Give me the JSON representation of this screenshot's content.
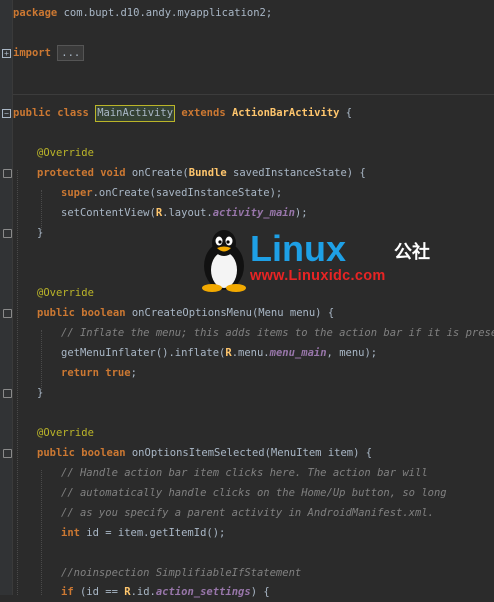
{
  "editor": {
    "theme_colors": {
      "background": "#2b2b2b",
      "keyword": "#cc7832",
      "annotation": "#bbb529",
      "comment": "#808080",
      "field": "#9876aa",
      "type": "#ffc66d"
    },
    "code": {
      "pkg_kw": "package",
      "pkg_name": " com.bupt.d10.andy.myapplication2;",
      "import_kw": "import",
      "import_folded": "...",
      "class_kw1": "public",
      "class_kw2": "class",
      "class_name": "MainActivity",
      "extends_kw": "extends",
      "super_class": "ActionBarActivity",
      "class_brace": " {",
      "ann1": "@Override",
      "m1_kw1": "protected",
      "m1_kw2": "void",
      "m1_name": " onCreate(",
      "m1_type": "Bundle",
      "m1_param": " savedInstanceState) {",
      "m1_l1_kw": "super",
      "m1_l1_rest": ".onCreate(savedInstanceState);",
      "m1_l2_a": "setContentView(",
      "m1_l2_R": "R",
      "m1_l2_b": ".layout.",
      "m1_l2_field": "activity_main",
      "m1_l2_c": ");",
      "close1": "}",
      "ann2": "@Override",
      "m2_kw1": "public",
      "m2_kw2": "boolean",
      "m2_sig": " onCreateOptionsMenu(Menu menu) {",
      "m2_comment": "// Inflate the menu; this adds items to the action bar if it is present.",
      "m2_l2_a": "getMenuInflater().inflate(",
      "m2_l2_R": "R",
      "m2_l2_b": ".menu.",
      "m2_l2_field": "menu_main",
      "m2_l2_c": ", menu);",
      "m2_ret_kw": "return",
      "m2_ret_val": "true",
      "m2_ret_end": ";",
      "close2": "}",
      "ann3": "@Override",
      "m3_kw1": "public",
      "m3_kw2": "boolean",
      "m3_sig": " onOptionsItemSelected(MenuItem item) {",
      "m3_c1": "// Handle action bar item clicks here. The action bar will",
      "m3_c2": "// automatically handle clicks on the Home/Up button, so long",
      "m3_c3": "// as you specify a parent activity in AndroidManifest.xml.",
      "m3_l4_kw": "int",
      "m3_l4_rest": " id = item.getItemId();",
      "m3_c5": "//noinspection SimplifiableIfStatement",
      "m3_l6_kw": "if",
      "m3_l6_a": " (id == ",
      "m3_l6_R": "R",
      "m3_l6_b": ".id.",
      "m3_l6_field": "action_settings",
      "m3_l6_c": ") {"
    }
  },
  "watermark": {
    "brand": "Linux",
    "brand_cn": "公社",
    "url": "www.Linuxidc.com"
  }
}
